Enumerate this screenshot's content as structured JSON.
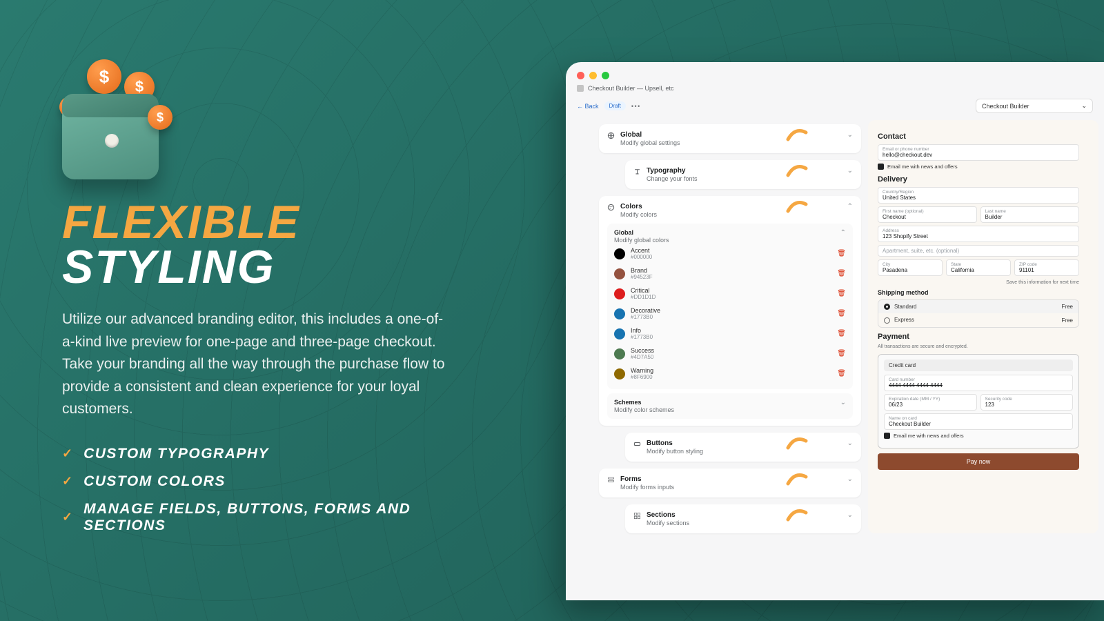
{
  "marketing": {
    "headline_a": "Flexible",
    "headline_b": "Styling",
    "description": "Utilize our advanced branding editor, this includes a one-of-a-kind live preview for one-page and three-page checkout. Take your branding all the way through the purchase flow to provide a consistent and clean experience for your loyal customers.",
    "features": [
      "Custom Typography",
      "Custom Colors",
      "Manage Fields, Buttons, Forms and Sections"
    ]
  },
  "app": {
    "crumb": "Checkout Builder — Upsell, etc",
    "back": "Back",
    "status_badge": "Draft",
    "selector": "Checkout Builder"
  },
  "editor": {
    "global": {
      "title": "Global",
      "sub": "Modify global settings"
    },
    "typography": {
      "title": "Typography",
      "sub": "Change your fonts"
    },
    "colors": {
      "title": "Colors",
      "sub": "Modify colors",
      "global": {
        "title": "Global",
        "sub": "Modify global colors"
      },
      "items": [
        {
          "name": "Accent",
          "value": "#000000",
          "hex": "#000000"
        },
        {
          "name": "Brand",
          "value": "#94523F",
          "hex": "#94523F"
        },
        {
          "name": "Critical",
          "value": "#DD1D1D",
          "hex": "#DD1D1D"
        },
        {
          "name": "Decorative",
          "value": "#1773B0",
          "hex": "#1773B0"
        },
        {
          "name": "Info",
          "value": "#1773B0",
          "hex": "#1773B0"
        },
        {
          "name": "Success",
          "value": "#4D7A50",
          "hex": "#4D7A50"
        },
        {
          "name": "Warning",
          "value": "#8F6900",
          "hex": "#8F6900"
        }
      ],
      "schemes": {
        "title": "Schemes",
        "sub": "Modify color schemes"
      }
    },
    "buttons": {
      "title": "Buttons",
      "sub": "Modify button styling"
    },
    "forms": {
      "title": "Forms",
      "sub": "Modify forms inputs"
    },
    "sections": {
      "title": "Sections",
      "sub": "Modify sections"
    }
  },
  "preview": {
    "contact": {
      "title": "Contact",
      "email_label": "Email or phone number",
      "email_value": "hello@checkout.dev",
      "newsletter": "Email me with news and offers"
    },
    "delivery": {
      "title": "Delivery",
      "country_label": "Country/Region",
      "country_value": "United States",
      "first_label": "First name (optional)",
      "first_value": "Checkout",
      "last_label": "Last name",
      "last_value": "Builder",
      "addr_label": "Address",
      "addr_value": "123 Shopify Street",
      "addr2_placeholder": "Apartment, suite, etc. (optional)",
      "city_label": "City",
      "city_value": "Pasadena",
      "state_label": "State",
      "state_value": "California",
      "zip_label": "ZIP code",
      "zip_value": "91101",
      "save_info": "Save this information for next time"
    },
    "shipping": {
      "title": "Shipping method",
      "standard": "Standard",
      "express": "Express",
      "free": "Free"
    },
    "payment": {
      "title": "Payment",
      "note": "All transactions are secure and encrypted.",
      "method": "Credit card",
      "card_label": "Card number",
      "card_value": "4444 4444 4444 4444",
      "exp_label": "Expiration date (MM / YY)",
      "exp_value": "06/23",
      "cvv_label": "Security code",
      "cvv_value": "123",
      "name_label": "Name on card",
      "name_value": "Checkout Builder",
      "news2": "Email me with news and offers",
      "cta": "Pay now"
    }
  }
}
